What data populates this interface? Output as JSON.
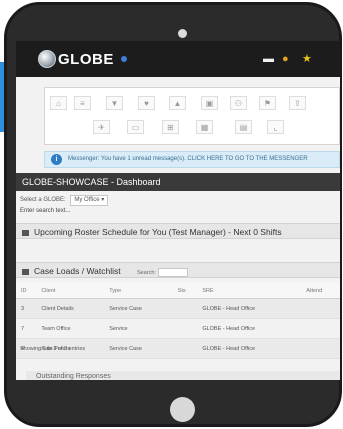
{
  "topbar": {
    "logo_text": "GLOBE",
    "icons": [
      "envelope-icon",
      "badge-icon",
      "star-icon"
    ]
  },
  "toolbar": {
    "row1": [
      "home-icon",
      "list-icon",
      "filter-icon",
      "heart-icon",
      "alert-icon",
      "briefcase-icon",
      "people-icon",
      "pin-icon",
      "upload-icon"
    ],
    "row2": [
      "plane-icon",
      "document-icon",
      "grid-icon",
      "table-icon",
      "window-icon",
      "chart-icon"
    ],
    "row1_glyphs": [
      "⌂",
      "≡",
      "▼",
      "♥",
      "▲",
      "▣",
      "⚇",
      "⚑",
      "⇪"
    ],
    "row2_glyphs": [
      "✈",
      "▭",
      "⊞",
      "▦",
      "▤",
      "⌞"
    ]
  },
  "banner": {
    "text": "Messenger: You have 1 unread message(s). CLICK HERE TO GO TO THE MESSENGER"
  },
  "page": {
    "title": "GLOBE-SHOWCASE - Dashboard"
  },
  "filters": {
    "label": "Select a GLOBE:",
    "value": "My Office",
    "hint": "Enter search text..."
  },
  "sections": {
    "roster_title": "Upcoming Roster Schedule for You (Test Manager) - Next 0 Shifts",
    "watchlist_title": "Case Loads / Watchlist",
    "search_label": "Search:",
    "search_placeholder": "Type here...",
    "outstanding_title": "Outstanding Responses"
  },
  "watchlist": {
    "columns": [
      "ID",
      "Client",
      "Type",
      "Sts",
      "SRE",
      "Attend"
    ],
    "rows": [
      [
        "3",
        "Client Details",
        "Service Case",
        "",
        "GLOBE - Head Office",
        ""
      ],
      [
        "7",
        "Team Office",
        "Service",
        "",
        "GLOBE - Head Office",
        ""
      ],
      [
        "4",
        "Kate Peters",
        "Service Case",
        "",
        "GLOBE - Head Office",
        ""
      ]
    ],
    "footer": "Showing 1 to 3 of 3 entries"
  }
}
